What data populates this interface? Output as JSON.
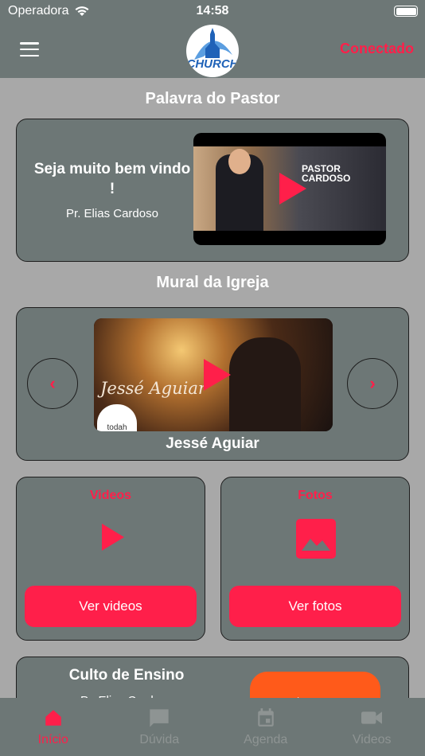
{
  "status_bar": {
    "carrier": "Operadora",
    "time": "14:58"
  },
  "header": {
    "logo_text": "CHURCH",
    "status_label": "Conectado"
  },
  "pastor_section": {
    "title": "Palavra do Pastor",
    "welcome_title": "Seja muito bem vindo !",
    "pastor_name": "Pr. Elias Cardoso",
    "video_overlay_line1": "PASTOR",
    "video_overlay_line2": "CARDOSO"
  },
  "mural_section": {
    "title": "Mural da Igreja",
    "video_overlay_text": "Jessé Aguiar",
    "caption": "Jessé Aguiar",
    "brand_text": "todah"
  },
  "videos_tile": {
    "title": "Videos",
    "button_label": "Ver videos"
  },
  "photos_tile": {
    "title": "Fotos",
    "button_label": "Ver fotos"
  },
  "teaching_section": {
    "title": "Culto de Ensino",
    "subtitle": "Pr. Elias Cardoso"
  },
  "tabbar": {
    "tabs": [
      {
        "label": "Início",
        "icon": "home-icon",
        "active": true
      },
      {
        "label": "Dúvida",
        "icon": "chat-icon",
        "active": false
      },
      {
        "label": "Agenda",
        "icon": "calendar-icon",
        "active": false
      },
      {
        "label": "Videos",
        "icon": "videocam-icon",
        "active": false
      }
    ]
  },
  "colors": {
    "accent": "#ff1f4a",
    "bar": "#6d7776",
    "background": "#a8a8a8",
    "youtube": "#ff5a1a"
  }
}
